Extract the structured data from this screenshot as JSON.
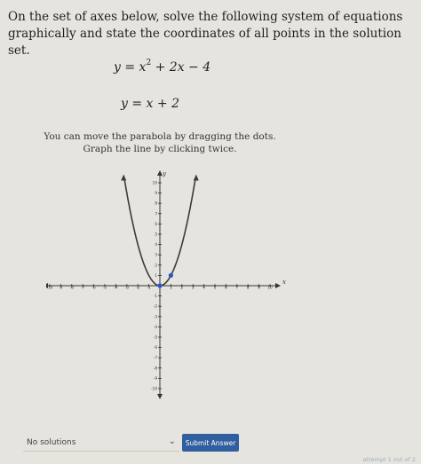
{
  "prompt": {
    "text": "On the set of axes below, solve the following system of equations graphically and state the coordinates of all points in the solution set."
  },
  "equations": {
    "eq1": {
      "lhs": "y = x",
      "exp": "2",
      "rhs": " + 2x − 4"
    },
    "eq2": "y = x + 2"
  },
  "instructions": {
    "line1": "You can move the parabola by dragging the dots.",
    "line2": "Graph the line by clicking twice."
  },
  "graph": {
    "xlabel": "x",
    "ylabel": "y",
    "xlim": [
      -10,
      10
    ],
    "ylim": [
      -10,
      10
    ],
    "x_ticks": [
      -10,
      -9,
      -8,
      -7,
      -6,
      -5,
      -4,
      -3,
      -2,
      -1,
      1,
      2,
      3,
      4,
      5,
      6,
      7,
      8,
      9,
      10
    ],
    "y_ticks": [
      10,
      9,
      8,
      7,
      6,
      5,
      4,
      3,
      2,
      1,
      -1,
      -2,
      -3,
      -4,
      -5,
      -6,
      -7,
      -8,
      -9,
      -10
    ],
    "parabola": {
      "vertex": [
        0,
        0
      ],
      "point": [
        1,
        1
      ],
      "color": "#3a3a3a"
    },
    "handles": [
      {
        "name": "vertex-handle",
        "x": 0,
        "y": 0,
        "color": "#2a56c6"
      },
      {
        "name": "point-handle",
        "x": 1,
        "y": 1,
        "color": "#2a56c6"
      }
    ]
  },
  "answer": {
    "select_value": "No solutions",
    "submit_label": "Submit Answer",
    "attempt_text": "attempt 1 out of 2"
  },
  "colors": {
    "accent": "#2f5f9f",
    "handle": "#2a56c6"
  }
}
